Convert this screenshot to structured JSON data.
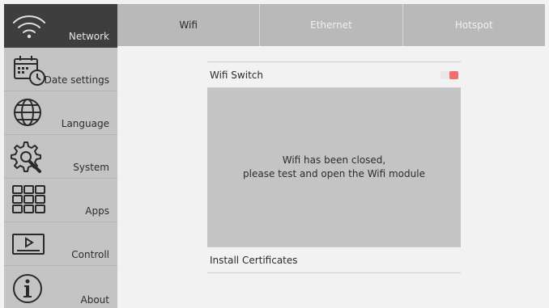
{
  "sidebar": {
    "items": [
      {
        "label": "Network",
        "icon": "wifi-icon",
        "active": true
      },
      {
        "label": "Date settings",
        "icon": "calendar-clock-icon",
        "active": false
      },
      {
        "label": "Language",
        "icon": "globe-icon",
        "active": false
      },
      {
        "label": "System",
        "icon": "gears-icon",
        "active": false
      },
      {
        "label": "Apps",
        "icon": "apps-grid-icon",
        "active": false
      },
      {
        "label": "Controll",
        "icon": "player-icon",
        "active": false
      },
      {
        "label": "About",
        "icon": "info-icon",
        "active": false
      }
    ]
  },
  "tabs": [
    {
      "label": "Wifi",
      "active": true
    },
    {
      "label": "Ethernet",
      "active": false
    },
    {
      "label": "Hotspot",
      "active": false
    }
  ],
  "wifi": {
    "switch_label": "Wifi Switch",
    "switch_on": false,
    "closed_line1": "Wifi has been closed,",
    "closed_line2": "please test and open the Wifi module",
    "install_certificates": "Install Certificates"
  },
  "colors": {
    "sidebar_active": "#3e3e3e",
    "sidebar_bg": "#c4c4c4",
    "tab_bar": "#b9b9b9",
    "toggle_knob": "#f26f6f"
  }
}
